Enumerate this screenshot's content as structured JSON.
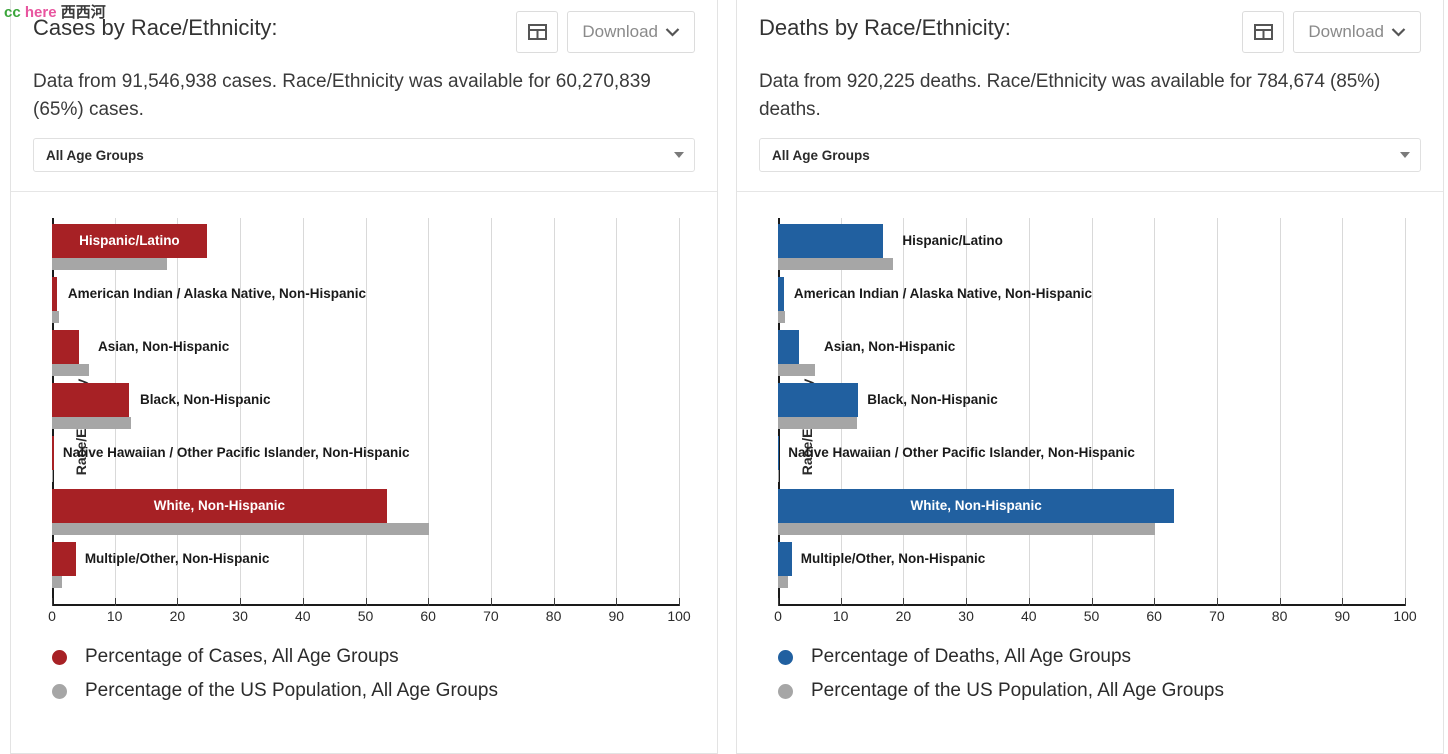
{
  "watermark": {
    "cc": "cc",
    "here": "here",
    "cn": "西西河"
  },
  "panels": [
    {
      "id": "cases",
      "title": "Cases by Race/Ethnicity:",
      "description": "Data from 91,546,938 cases. Race/Ethnicity was available for 60,270,839 (65%) cases.",
      "toolbar": {
        "table_icon": "table-icon",
        "download_label": "Download",
        "chevron": "chevron-down-icon"
      },
      "age_filter": {
        "value": "All Age Groups",
        "placeholder": "All Age Groups"
      },
      "chart_data": {
        "type": "bar",
        "title": "Cases by Race/Ethnicity:",
        "xlabel": "",
        "ylabel": "Race/Ethnicity",
        "xlim": [
          0,
          100
        ],
        "grid": true,
        "legend_position": "bottom-left",
        "xticks": [
          0,
          10,
          20,
          30,
          40,
          50,
          60,
          70,
          80,
          90,
          100
        ],
        "categories": [
          "Hispanic/Latino",
          "American Indian / Alaska Native, Non-Hispanic",
          "Asian, Non-Hispanic",
          "Black, Non-Hispanic",
          "Native Hawaiian / Other Pacific Islander, Non-Hispanic",
          "White, Non-Hispanic",
          "Multiple/Other, Non-Hispanic"
        ],
        "series": [
          {
            "name": "Percentage of Cases, All Age Groups",
            "color": "#a72125",
            "values": [
              24.7,
              0.8,
              4.3,
              12.3,
              0.3,
              53.4,
              3.8
            ]
          },
          {
            "name": "Percentage of the US Population, All Age Groups",
            "color": "#a6a6a6",
            "values": [
              18.4,
              1.1,
              5.9,
              12.6,
              0.2,
              60.1,
              1.6
            ]
          }
        ]
      }
    },
    {
      "id": "deaths",
      "title": "Deaths by Race/Ethnicity:",
      "description": "Data from 920,225 deaths. Race/Ethnicity was available for 784,674 (85%) deaths.",
      "toolbar": {
        "table_icon": "table-icon",
        "download_label": "Download",
        "chevron": "chevron-down-icon"
      },
      "age_filter": {
        "value": "All Age Groups",
        "placeholder": "All Age Groups"
      },
      "chart_data": {
        "type": "bar",
        "title": "Deaths by Race/Ethnicity:",
        "xlabel": "",
        "ylabel": "Race/Ethnicity",
        "xlim": [
          0,
          100
        ],
        "grid": true,
        "legend_position": "bottom-left",
        "xticks": [
          0,
          10,
          20,
          30,
          40,
          50,
          60,
          70,
          80,
          90,
          100
        ],
        "categories": [
          "Hispanic/Latino",
          "American Indian / Alaska Native, Non-Hispanic",
          "Asian, Non-Hispanic",
          "Black, Non-Hispanic",
          "Native Hawaiian / Other Pacific Islander, Non-Hispanic",
          "White, Non-Hispanic",
          "Multiple/Other, Non-Hispanic"
        ],
        "series": [
          {
            "name": "Percentage of Deaths, All Age Groups",
            "color": "#2160a0",
            "values": [
              16.8,
              0.9,
              3.4,
              12.8,
              0.2,
              63.2,
              2.2
            ]
          },
          {
            "name": "Percentage of the US Population, All Age Groups",
            "color": "#a6a6a6",
            "values": [
              18.4,
              1.1,
              5.9,
              12.6,
              0.2,
              60.1,
              1.6
            ]
          }
        ]
      }
    }
  ]
}
